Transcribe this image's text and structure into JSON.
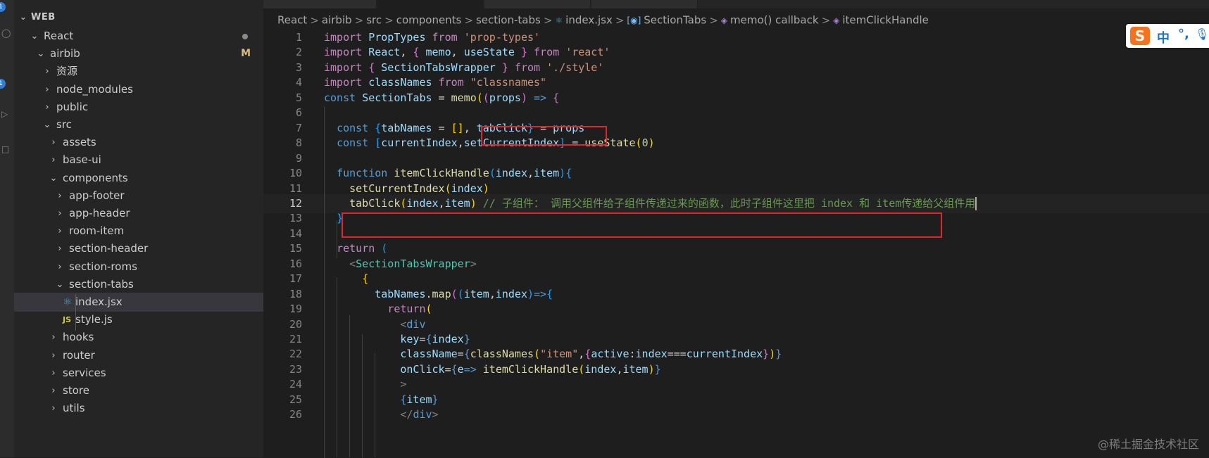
{
  "explorer": {
    "header": "WEB",
    "items": [
      {
        "label": "React",
        "depth": 0,
        "expanded": true,
        "status": "dot"
      },
      {
        "label": "airbib",
        "depth": 1,
        "expanded": true,
        "status": "M"
      },
      {
        "label": "资源",
        "depth": 2,
        "expanded": false
      },
      {
        "label": "node_modules",
        "depth": 2,
        "expanded": false
      },
      {
        "label": "public",
        "depth": 2,
        "expanded": false
      },
      {
        "label": "src",
        "depth": 2,
        "expanded": true
      },
      {
        "label": "assets",
        "depth": 3,
        "expanded": false
      },
      {
        "label": "base-ui",
        "depth": 3,
        "expanded": false
      },
      {
        "label": "components",
        "depth": 3,
        "expanded": true
      },
      {
        "label": "app-footer",
        "depth": 4,
        "expanded": false
      },
      {
        "label": "app-header",
        "depth": 4,
        "expanded": false
      },
      {
        "label": "room-item",
        "depth": 4,
        "expanded": false
      },
      {
        "label": "section-header",
        "depth": 4,
        "expanded": false
      },
      {
        "label": "section-roms",
        "depth": 4,
        "expanded": false
      },
      {
        "label": "section-tabs",
        "depth": 4,
        "expanded": true
      },
      {
        "label": "index.jsx",
        "depth": 5,
        "file": "react",
        "selected": true
      },
      {
        "label": "style.js",
        "depth": 5,
        "file": "js"
      },
      {
        "label": "hooks",
        "depth": 3,
        "expanded": false
      },
      {
        "label": "router",
        "depth": 3,
        "expanded": false
      },
      {
        "label": "services",
        "depth": 3,
        "expanded": false
      },
      {
        "label": "store",
        "depth": 3,
        "expanded": false
      },
      {
        "label": "utils",
        "depth": 3,
        "expanded": false
      }
    ],
    "modified_marker": "M",
    "js_badge": "JS"
  },
  "breadcrumb": {
    "segments": [
      "React",
      "airbib",
      "src",
      "components",
      "section-tabs"
    ],
    "file": "index.jsx",
    "symbols": [
      "SectionTabs",
      "memo() callback",
      "itemClickHandle"
    ],
    "separator": ">"
  },
  "activity_badges": [
    "1",
    "1"
  ],
  "editor": {
    "current_line": 12,
    "lines": [
      {
        "n": "1",
        "tokens": [
          [
            "kw",
            "import "
          ],
          [
            "var",
            "PropTypes "
          ],
          [
            "kw",
            "from "
          ],
          [
            "str",
            "'prop-types'"
          ]
        ]
      },
      {
        "n": "2",
        "tokens": [
          [
            "kw",
            "import "
          ],
          [
            "var",
            "React"
          ],
          [
            "plain",
            ", "
          ],
          [
            "br2",
            "{ "
          ],
          [
            "var",
            "memo"
          ],
          [
            "plain",
            ", "
          ],
          [
            "var",
            "useState "
          ],
          [
            "br2",
            "} "
          ],
          [
            "kw",
            "from "
          ],
          [
            "str",
            "'react'"
          ]
        ]
      },
      {
        "n": "3",
        "tokens": [
          [
            "kw",
            "import "
          ],
          [
            "br2",
            "{ "
          ],
          [
            "var",
            "SectionTabsWrapper "
          ],
          [
            "br2",
            "} "
          ],
          [
            "kw",
            "from "
          ],
          [
            "str",
            "'./style'"
          ]
        ]
      },
      {
        "n": "4",
        "tokens": [
          [
            "kw",
            "import "
          ],
          [
            "var",
            "classNames "
          ],
          [
            "kw",
            "from "
          ],
          [
            "str",
            "\"classnames\""
          ]
        ]
      },
      {
        "n": "5",
        "tokens": [
          [
            "st",
            "const "
          ],
          [
            "var",
            "SectionTabs "
          ],
          [
            "plain",
            "= "
          ],
          [
            "fn",
            "memo"
          ],
          [
            "br1",
            "("
          ],
          [
            "br2",
            "("
          ],
          [
            "var",
            "props"
          ],
          [
            "br2",
            ") "
          ],
          [
            "st",
            "=> "
          ],
          [
            "br2",
            "{"
          ]
        ]
      },
      {
        "n": "6",
        "tokens": []
      },
      {
        "n": "7",
        "tokens": [
          [
            "plain",
            "  "
          ],
          [
            "st",
            "const "
          ],
          [
            "br3",
            "{"
          ],
          [
            "var",
            "tabNames "
          ],
          [
            "plain",
            "= "
          ],
          [
            "br1",
            "[]"
          ],
          [
            "plain",
            ", "
          ],
          [
            "var",
            "tabClick"
          ],
          [
            "br3",
            "} "
          ],
          [
            "plain",
            "= "
          ],
          [
            "var",
            "props"
          ]
        ]
      },
      {
        "n": "8",
        "tokens": [
          [
            "plain",
            "  "
          ],
          [
            "st",
            "const "
          ],
          [
            "br3",
            "["
          ],
          [
            "var",
            "currentIndex"
          ],
          [
            "plain",
            ","
          ],
          [
            "var",
            "setCurrentIndex"
          ],
          [
            "br3",
            "] "
          ],
          [
            "plain",
            "= "
          ],
          [
            "fn",
            "useState"
          ],
          [
            "br1",
            "("
          ],
          [
            "num",
            "0"
          ],
          [
            "br1",
            ")"
          ]
        ]
      },
      {
        "n": "9",
        "tokens": []
      },
      {
        "n": "10",
        "tokens": [
          [
            "plain",
            "  "
          ],
          [
            "st",
            "function "
          ],
          [
            "fn",
            "itemClickHandle"
          ],
          [
            "br3",
            "("
          ],
          [
            "var",
            "index"
          ],
          [
            "plain",
            ","
          ],
          [
            "var",
            "item"
          ],
          [
            "br3",
            ")"
          ],
          [
            "br3",
            "{"
          ]
        ]
      },
      {
        "n": "11",
        "tokens": [
          [
            "plain",
            "    "
          ],
          [
            "fn",
            "setCurrentIndex"
          ],
          [
            "br1",
            "("
          ],
          [
            "var",
            "index"
          ],
          [
            "br1",
            ")"
          ]
        ]
      },
      {
        "n": "12",
        "tokens": [
          [
            "plain",
            "    "
          ],
          [
            "fn",
            "tabClick"
          ],
          [
            "br1",
            "("
          ],
          [
            "var",
            "index"
          ],
          [
            "plain",
            ","
          ],
          [
            "var",
            "item"
          ],
          [
            "br1",
            ") "
          ],
          [
            "cmt",
            "// 子组件： 调用父组件给子组件传递过来的函数，此时子组件这里把 index 和 item传递给父组件用"
          ]
        ]
      },
      {
        "n": "13",
        "tokens": [
          [
            "plain",
            "  "
          ],
          [
            "br3",
            "}"
          ]
        ]
      },
      {
        "n": "14",
        "tokens": []
      },
      {
        "n": "15",
        "tokens": [
          [
            "plain",
            "  "
          ],
          [
            "kw",
            "return "
          ],
          [
            "br3",
            "("
          ]
        ]
      },
      {
        "n": "16",
        "tokens": [
          [
            "plain",
            "    "
          ],
          [
            "tag",
            "<"
          ],
          [
            "cls",
            "SectionTabsWrapper"
          ],
          [
            "tag",
            ">"
          ]
        ]
      },
      {
        "n": "17",
        "tokens": [
          [
            "plain",
            "      "
          ],
          [
            "br1",
            "{"
          ]
        ]
      },
      {
        "n": "18",
        "tokens": [
          [
            "plain",
            "        "
          ],
          [
            "var",
            "tabNames"
          ],
          [
            "plain",
            "."
          ],
          [
            "fn",
            "map"
          ],
          [
            "br2",
            "("
          ],
          [
            "br3",
            "("
          ],
          [
            "var",
            "item"
          ],
          [
            "plain",
            ","
          ],
          [
            "var",
            "index"
          ],
          [
            "br3",
            ")"
          ],
          [
            "st",
            "=>"
          ],
          [
            "br3",
            "{"
          ]
        ]
      },
      {
        "n": "19",
        "tokens": [
          [
            "plain",
            "          "
          ],
          [
            "kw",
            "return"
          ],
          [
            "br1",
            "("
          ]
        ]
      },
      {
        "n": "20",
        "tokens": [
          [
            "plain",
            "            "
          ],
          [
            "tag",
            "<"
          ],
          [
            "st",
            "div"
          ]
        ]
      },
      {
        "n": "21",
        "tokens": [
          [
            "plain",
            "            "
          ],
          [
            "var",
            "key"
          ],
          [
            "plain",
            "="
          ],
          [
            "st",
            "{"
          ],
          [
            "var",
            "index"
          ],
          [
            "st",
            "}"
          ]
        ]
      },
      {
        "n": "22",
        "tokens": [
          [
            "plain",
            "            "
          ],
          [
            "var",
            "className"
          ],
          [
            "plain",
            "="
          ],
          [
            "st",
            "{"
          ],
          [
            "fn",
            "classNames"
          ],
          [
            "br1",
            "("
          ],
          [
            "str",
            "\"item\""
          ],
          [
            "plain",
            ","
          ],
          [
            "br2",
            "{"
          ],
          [
            "var",
            "active"
          ],
          [
            "plain",
            ":"
          ],
          [
            "var",
            "index"
          ],
          [
            "plain",
            "==="
          ],
          [
            "var",
            "currentIndex"
          ],
          [
            "br2",
            "}"
          ],
          [
            "br1",
            ")"
          ],
          [
            "st",
            "}"
          ]
        ]
      },
      {
        "n": "23",
        "tokens": [
          [
            "plain",
            "            "
          ],
          [
            "var",
            "onClick"
          ],
          [
            "plain",
            "="
          ],
          [
            "st",
            "{"
          ],
          [
            "var",
            "e"
          ],
          [
            "st",
            "=> "
          ],
          [
            "fn",
            "itemClickHandle"
          ],
          [
            "br1",
            "("
          ],
          [
            "var",
            "index"
          ],
          [
            "plain",
            ","
          ],
          [
            "var",
            "item"
          ],
          [
            "br1",
            ")"
          ],
          [
            "st",
            "}"
          ]
        ]
      },
      {
        "n": "24",
        "tokens": [
          [
            "plain",
            "            "
          ],
          [
            "tag",
            ">"
          ]
        ]
      },
      {
        "n": "25",
        "tokens": [
          [
            "plain",
            "            "
          ],
          [
            "st",
            "{"
          ],
          [
            "var",
            "item"
          ],
          [
            "st",
            "}"
          ]
        ]
      },
      {
        "n": "26",
        "tokens": [
          [
            "plain",
            "            "
          ],
          [
            "tag",
            "</"
          ],
          [
            "st",
            "div"
          ],
          [
            "tag",
            ">"
          ]
        ]
      }
    ]
  },
  "ime": {
    "logo": "S",
    "mode": "中",
    "punct": "°,",
    "mic": "🎙"
  },
  "watermark": "@稀土掘金技术社区",
  "colors": {
    "annotation_box": "#e0262d",
    "background": "#1e1e1e",
    "sidebar": "#252526"
  }
}
